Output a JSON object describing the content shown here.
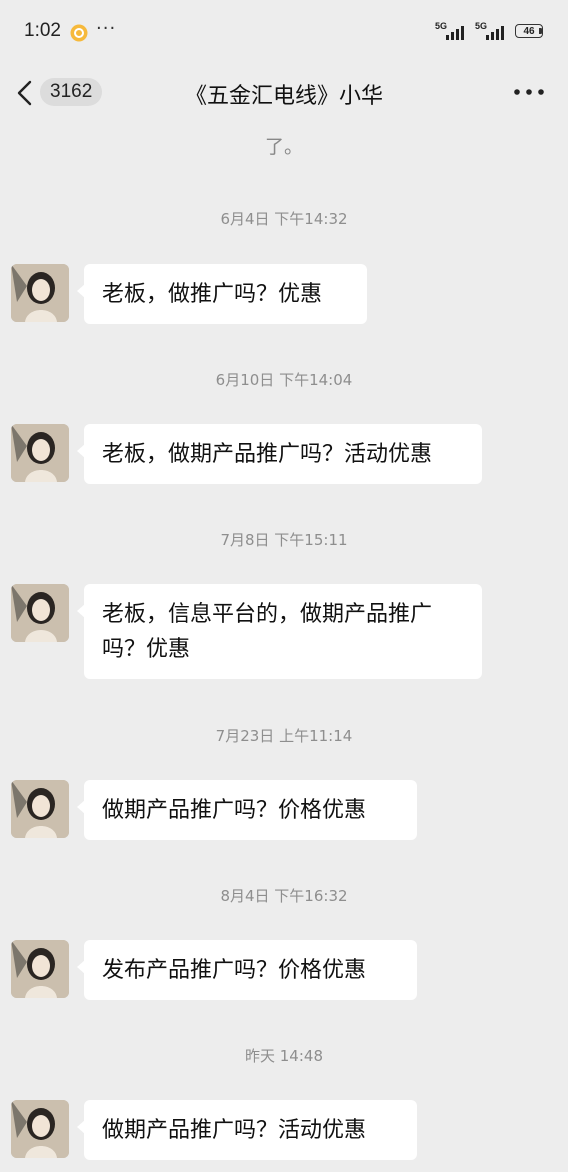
{
  "status_bar": {
    "time": "1:02",
    "more": "···",
    "signal1_label": "5G",
    "signal2_label": "5G",
    "battery": "46",
    "notification_icon": "notification-app-icon"
  },
  "header": {
    "unread_count": "3162",
    "title": "《五金汇电线》小华",
    "back_icon": "chevron-left-icon",
    "more_icon": "more-horizontal-icon"
  },
  "conversation": {
    "clipped_text": "了。",
    "messages": [
      {
        "time": "6月4日 下午14:32",
        "text": "老板，做推广吗？优惠"
      },
      {
        "time": "6月10日 下午14:04",
        "text": "老板，做期产品推广吗？活动优惠"
      },
      {
        "time": "7月8日 下午15:11",
        "text": "老板，信息平台的，做期产品推广\n吗？优惠"
      },
      {
        "time": "7月23日 上午11:14",
        "text": "做期产品推广吗？价格优惠"
      },
      {
        "time": "8月4日 下午16:32",
        "text": "发布产品推广吗？价格优惠"
      },
      {
        "time": "昨天 14:48",
        "text": "做期产品推广吗？活动优惠"
      }
    ]
  }
}
